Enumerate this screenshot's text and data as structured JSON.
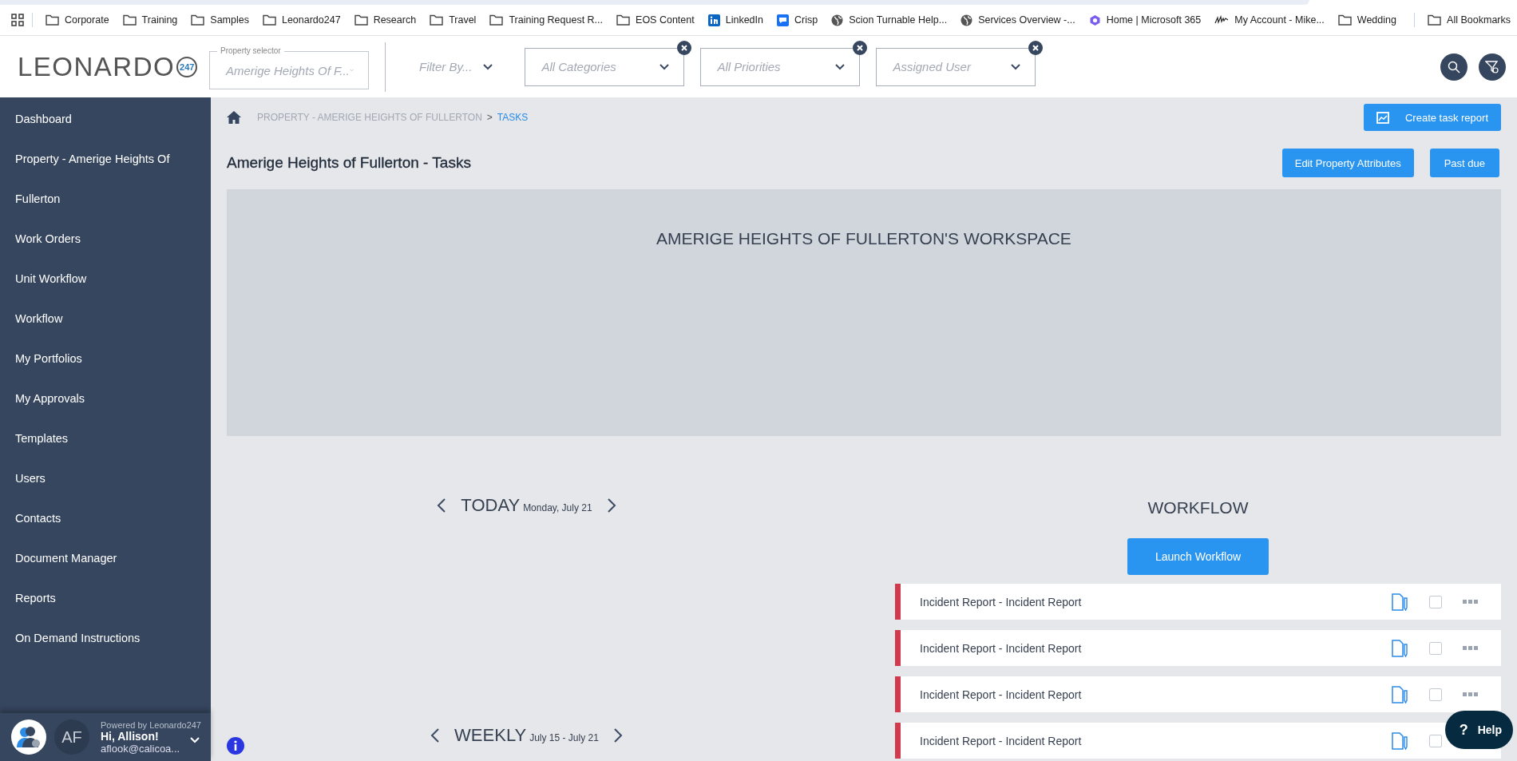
{
  "bookmarks": [
    {
      "kind": "apps"
    },
    {
      "kind": "folder",
      "label": "Corporate"
    },
    {
      "kind": "folder",
      "label": "Training"
    },
    {
      "kind": "folder",
      "label": "Samples"
    },
    {
      "kind": "folder",
      "label": "Leonardo247"
    },
    {
      "kind": "folder",
      "label": "Research"
    },
    {
      "kind": "folder",
      "label": "Travel"
    },
    {
      "kind": "folder",
      "label": "Training Request R..."
    },
    {
      "kind": "folder",
      "label": "EOS Content"
    },
    {
      "kind": "linkedin",
      "label": "LinkedIn"
    },
    {
      "kind": "chat",
      "label": "Crisp"
    },
    {
      "kind": "globe",
      "label": "Scion Turnable Help..."
    },
    {
      "kind": "globe",
      "label": "Services Overview -..."
    },
    {
      "kind": "ring",
      "label": "Home | Microsoft 365"
    },
    {
      "kind": "scribble",
      "label": "My Account - Mike..."
    },
    {
      "kind": "folder",
      "label": "Wedding"
    }
  ],
  "all_bookmarks": "All Bookmarks",
  "header": {
    "logo": "LEONARDO",
    "logo_badge": "247",
    "property_selector": {
      "label": "Property selector",
      "placeholder": "Amerige Heights Of F..."
    },
    "filter_by": "Filter By...",
    "filters": [
      {
        "placeholder": "All Categories"
      },
      {
        "placeholder": "All Priorities"
      },
      {
        "placeholder": "Assigned User"
      }
    ]
  },
  "sidebar": {
    "items": [
      "Dashboard",
      "Property - Amerige Heights Of Fullerton",
      "Work Orders",
      "Unit Workflow",
      "Workflow",
      "My Portfolios",
      "My Approvals",
      "Templates",
      "Users",
      "Contacts",
      "Document Manager",
      "Reports",
      "On Demand Instructions"
    ],
    "footer": {
      "powered_by": "Powered by Leonardo247",
      "initials": "AF",
      "greeting": "Hi, Allison!",
      "email": "aflook@calicoa..."
    }
  },
  "breadcrumb": [
    "PROPERTY - AMERIGE HEIGHTS OF FULLERTON",
    "TASKS"
  ],
  "breadcrumb_separator": ">",
  "title": "Amerige Heights of Fullerton - Tasks",
  "buttons": {
    "create_report": "Create task report",
    "edit_attributes": "Edit Property Attributes",
    "past_due": "Past due"
  },
  "workspace": {
    "title": "AMERIGE HEIGHTS OF FULLERTON'S WORKSPACE"
  },
  "today": {
    "title": "TODAY",
    "date": "Monday, July 21"
  },
  "weekly": {
    "title": "WEEKLY",
    "date": "July 15 - July 21"
  },
  "workflow": {
    "title": "WORKFLOW",
    "launch": "Launch Workflow",
    "rows": [
      {
        "label": "Incident Report - Incident Report",
        "checked": false
      },
      {
        "label": "Incident Report - Incident Report",
        "checked": false
      },
      {
        "label": "Incident Report - Incident Report",
        "checked": false
      },
      {
        "label": "Incident Report - Incident Report",
        "checked": false
      }
    ]
  },
  "help": {
    "icon": "?",
    "label": "Help"
  }
}
